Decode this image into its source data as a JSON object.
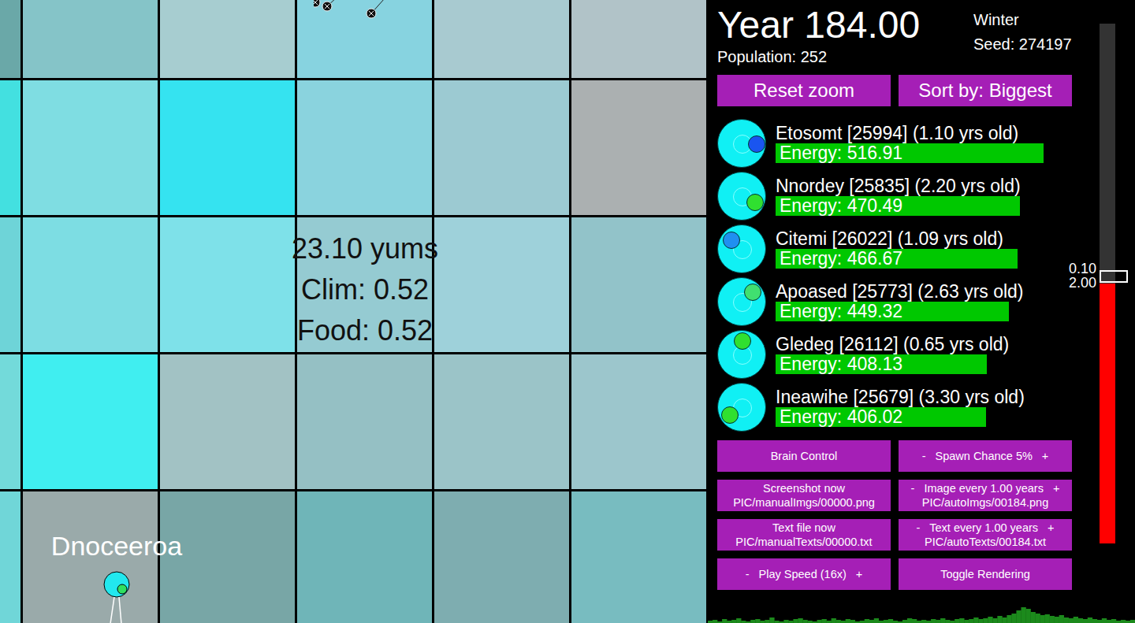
{
  "canvas": {
    "tiles": [
      [
        "#6aa8a8",
        "#85c4c8",
        "#a7cdd0",
        "#87d3e0",
        "#a8cad0",
        "#b1c3c8"
      ],
      [
        "#43e0e0",
        "#7fdde2",
        "#35e3f0",
        "#8ad3de",
        "#9ccad2",
        "#abb0b1"
      ],
      [
        "#6ed4d8",
        "#7ddde3",
        "#7ee1e9",
        "#95cbd2",
        "#9ed1da",
        "#92c3c9"
      ],
      [
        "#73dada",
        "#40eef0",
        "#a2c2c4",
        "#95c0c4",
        "#9bc4c8",
        "#9cc6cc"
      ],
      [
        "#70d6d8",
        "#9aaaaa",
        "#78a6a6",
        "#6fb5b8",
        "#7eadb0",
        "#78bcc0"
      ]
    ],
    "tile_info": [
      "23.10 yums",
      "Clim: 0.52",
      "Food: 0.52"
    ],
    "creature_label": "Dnoceeroa"
  },
  "header": {
    "year": "Year 184.00",
    "population": "Population: 252",
    "season": "Winter",
    "seed": "Seed: 274197"
  },
  "top_buttons": [
    "Reset zoom",
    "Sort by: Biggest"
  ],
  "creatures": [
    {
      "label": "Etosomt [25994] (1.10 yrs old)",
      "energy": "Energy: 516.91",
      "level": 0.907,
      "color": "#1a55f0",
      "facing": 0
    },
    {
      "label": "Nnordey [25835] (2.20 yrs old)",
      "energy": "Energy: 470.49",
      "level": 0.827,
      "color": "#30e030",
      "facing": 25
    },
    {
      "label": "Citemi [26022] (1.09 yrs old)",
      "energy": "Energy: 466.67",
      "level": 0.819,
      "color": "#2090f0",
      "facing": 220
    },
    {
      "label": "Apoased [25773] (2.63 yrs old)",
      "energy": "Energy: 449.32",
      "level": 0.789,
      "color": "#40e070",
      "facing": -45
    },
    {
      "label": "Gledeg [26112] (0.65 yrs old)",
      "energy": "Energy: 408.13",
      "level": 0.715,
      "color": "#30e030",
      "facing": -90
    },
    {
      "label": "Ineawihe [25679] (3.30 yrs old)",
      "energy": "Energy: 406.02",
      "level": 0.712,
      "color": "#30e030",
      "facing": 150
    }
  ],
  "controls": [
    {
      "kind": "button",
      "label": "Brain Control"
    },
    {
      "kind": "stepper",
      "minus": "-",
      "label": "Spawn Chance 5%",
      "plus": "+"
    },
    {
      "kind": "button",
      "label": "Screenshot now",
      "path": "PIC/manualImgs/00000.png"
    },
    {
      "kind": "stepper",
      "minus": "-",
      "label": "Image every 1.00 years",
      "plus": "+",
      "path": "PIC/autoImgs/00184.png"
    },
    {
      "kind": "button",
      "label": "Text file now",
      "path": "PIC/manualTexts/00000.txt"
    },
    {
      "kind": "stepper",
      "minus": "-",
      "label": "Text every 1.00 years",
      "plus": "+",
      "path": "PIC/autoTexts/00184.txt"
    },
    {
      "kind": "stepper",
      "minus": "-",
      "label": "Play Speed (16x)",
      "plus": "+"
    },
    {
      "kind": "button",
      "label": "Toggle Rendering"
    }
  ],
  "slider": {
    "labels": [
      "0.10",
      "2.00"
    ],
    "level": 0.5
  },
  "population_chart": {
    "values": [
      3,
      4,
      2,
      5,
      3,
      4,
      6,
      3,
      2,
      4,
      5,
      3,
      4,
      7,
      3,
      2,
      4,
      3,
      5,
      6,
      4,
      3,
      2,
      4,
      5,
      3,
      6,
      4,
      3,
      5,
      4,
      2,
      3,
      5,
      4,
      6,
      3,
      4,
      5,
      3,
      2,
      4,
      6,
      5,
      3,
      4,
      3,
      5,
      4,
      6,
      4,
      3,
      5,
      6,
      4,
      5,
      7,
      5,
      6,
      8,
      6,
      9,
      7,
      10,
      12,
      16,
      20,
      18,
      14,
      12,
      10,
      11,
      9,
      8,
      10,
      7,
      6,
      8,
      6,
      5,
      7,
      5,
      4,
      6,
      4,
      5,
      3,
      4,
      3,
      4
    ]
  }
}
